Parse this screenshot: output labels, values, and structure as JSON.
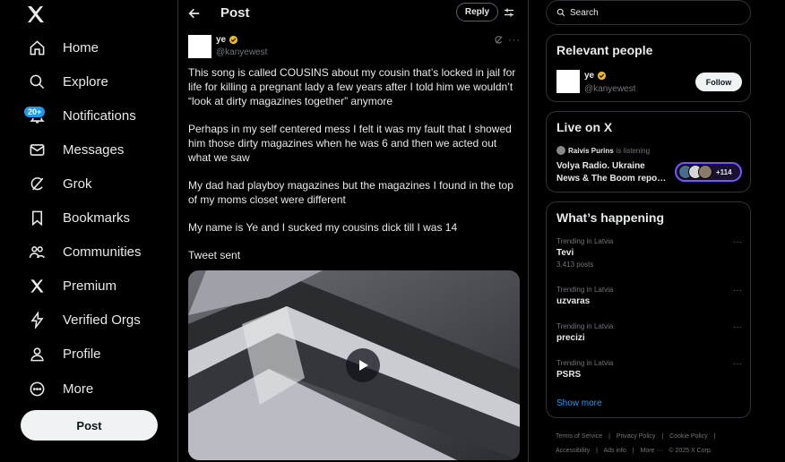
{
  "sidebar": {
    "logo_icon": "x-logo-icon",
    "notifications_badge": "20+",
    "items": [
      {
        "label": "Home",
        "icon": "home-icon"
      },
      {
        "label": "Explore",
        "icon": "search-icon"
      },
      {
        "label": "Notifications",
        "icon": "bell-icon"
      },
      {
        "label": "Messages",
        "icon": "envelope-icon"
      },
      {
        "label": "Grok",
        "icon": "grok-icon"
      },
      {
        "label": "Bookmarks",
        "icon": "bookmark-icon"
      },
      {
        "label": "Communities",
        "icon": "people-icon"
      },
      {
        "label": "Premium",
        "icon": "x-logo-icon"
      },
      {
        "label": "Verified Orgs",
        "icon": "lightning-icon"
      },
      {
        "label": "Profile",
        "icon": "person-icon"
      },
      {
        "label": "More",
        "icon": "more-circle-icon"
      }
    ],
    "post_label": "Post"
  },
  "header": {
    "title": "Post",
    "reply_label": "Reply"
  },
  "tweet": {
    "name": "ye",
    "handle": "@kanyewest",
    "paragraphs": [
      "This song is called COUSINS about my cousin that’s locked in jail for life for killing a pregnant lady a few years after I told him we wouldn’t “look at dirty magazines together” anymore",
      "Perhaps in my self centered mess I felt it was my fault that I showed him those dirty magazines when he was 6 and then we acted out what we saw",
      "My dad had playboy magazines but the magazines I found in the top of my moms closet were different",
      "My name is Ye and I sucked my cousins dick till I was 14",
      "Tweet sent"
    ]
  },
  "search": {
    "placeholder": "Search"
  },
  "relevant": {
    "title": "Relevant people",
    "name": "ye",
    "handle": "@kanyewest",
    "follow_label": "Follow"
  },
  "live": {
    "title": "Live on X",
    "host": "Raivis Purins",
    "host_status": "is listening",
    "space_title": "Volya Radio.  Ukraine News & The Boom repo…",
    "listener_count": "+114"
  },
  "happening": {
    "title": "What’s happening",
    "trends": [
      {
        "category": "Trending in Latvia",
        "name": "Tevi",
        "posts": "3,413 posts"
      },
      {
        "category": "Trending in Latvia",
        "name": "uzvaras",
        "posts": ""
      },
      {
        "category": "Trending in Latvia",
        "name": "precizi",
        "posts": ""
      },
      {
        "category": "Trending in Latvia",
        "name": "PSRS",
        "posts": ""
      }
    ],
    "show_more": "Show more"
  },
  "footer": {
    "links": [
      "Terms of Service",
      "|",
      "Privacy Policy",
      "|",
      "Cookie Policy",
      "|"
    ],
    "links2": [
      "Accessibility",
      "|",
      "Ads info",
      "|",
      "More ···",
      "© 2025 X Corp."
    ]
  },
  "colors": {
    "accent": "#1d9bf0",
    "verified": "#e8b829",
    "background": "#000000",
    "border": "#2f3336",
    "live": "#7856ff"
  }
}
